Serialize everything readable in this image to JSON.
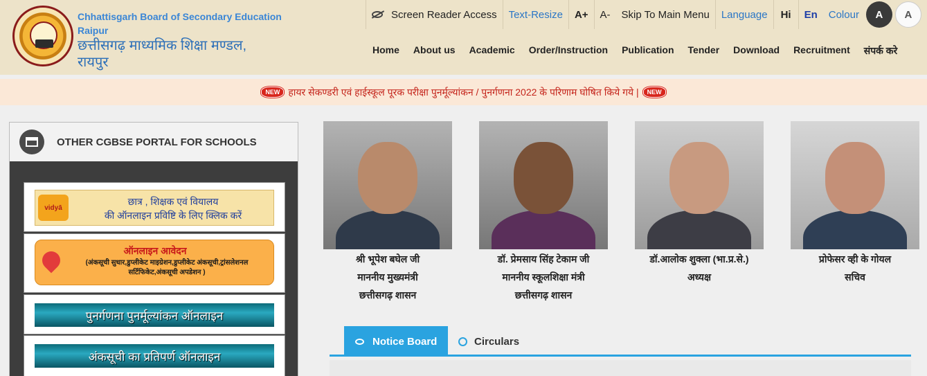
{
  "header": {
    "brand_en_line1": "Chhattisgarh Board of Secondary Education",
    "brand_en_line2": "Raipur",
    "brand_hi": "छत्तीसगढ़ माध्यमिक शिक्षा मण्डल, रायपुर"
  },
  "access_bar": {
    "screen_reader": "Screen Reader Access",
    "text_resize": "Text-Resize",
    "a_plus": "A+",
    "a_minus": "A-",
    "skip": "Skip To Main Menu",
    "language": "Language",
    "hi": "Hi",
    "en": "En",
    "colour": "Colour",
    "colour_dark": "A",
    "colour_light": "A"
  },
  "nav": {
    "items": [
      "Home",
      "About us",
      "Academic",
      "Order/Instruction",
      "Publication",
      "Tender",
      "Download",
      "Recruitment",
      "संपर्क करे"
    ]
  },
  "ticker": {
    "badge": "NEW",
    "text": "हायर सेकण्डरी एवं हाईस्कूल पूरक परीक्षा पुनर्मूल्यांकन / पुनर्गणना 2022 के परिणाम घोषित किये गये |"
  },
  "left_panel": {
    "title": "OTHER CGBSE PORTAL FOR SCHOOLS",
    "banner1": {
      "logo": "vidyā",
      "line1": "छात्र , शिक्षक एवं वियालय",
      "line2": "की ऑनलाइन प्रविष्टि के लिए क्लिक करें"
    },
    "banner2": {
      "line1": "ऑनलाइन आवेदन",
      "line2": "(अंकसूची सुधार,डुप्लीकेट माइग्रेशन,डुप्लीकेट अंकसूची,ट्रांसलेशनल सर्टिफिकेट,अंकसूची अपडेशन )"
    },
    "banner3": "पुनर्गणना पुनर्मूल्यांकन ऑनलाइन",
    "banner4": "अंकसूची का प्रतिपर्ण ऑनलाइन"
  },
  "officials": [
    {
      "name": "श्री भूपेश बघेल जी",
      "role": "माननीय मुख्यमंत्री",
      "org": "छत्तीसगढ़ शासन"
    },
    {
      "name": "डॉ. प्रेमसाय सिंह टेकाम जी",
      "role": "माननीय स्कूलशिक्षा मंत्री",
      "org": "छत्तीसगढ़ शासन"
    },
    {
      "name": "डॉ.आलोक शुक्ला (भा.प्र.से.)",
      "role": "अध्यक्ष",
      "org": ""
    },
    {
      "name": "प्रोफेसर व्ही के गोयल",
      "role": "सचिव",
      "org": ""
    }
  ],
  "tabs": {
    "notice_board": "Notice Board",
    "circulars": "Circulars"
  },
  "colors": {
    "accent": "#2aa3e0",
    "ticker_text": "#c4231a",
    "brand_blue": "#3a86d6"
  }
}
